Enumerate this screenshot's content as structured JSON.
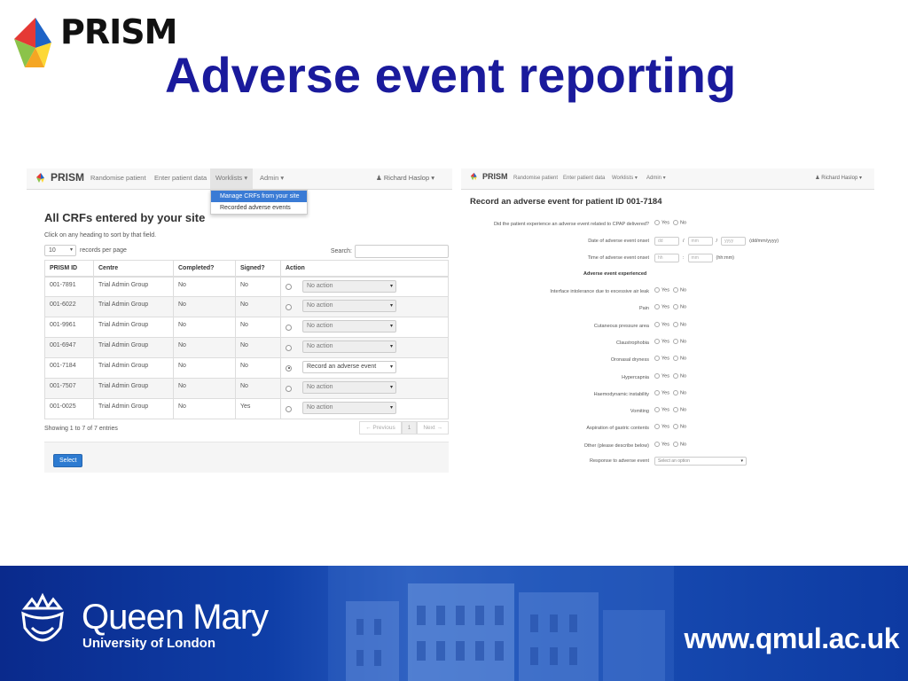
{
  "slide": {
    "logo_text": "PRISM",
    "title": "Adverse event reporting"
  },
  "nav": {
    "brand": "PRISM",
    "items": [
      "Randomise patient",
      "Enter patient data",
      "Worklists ▾",
      "Admin ▾"
    ],
    "user": "Richard Haslop ▾"
  },
  "worklists_menu": {
    "items": [
      "Manage CRFs from your site",
      "Recorded adverse events"
    ]
  },
  "crf_list": {
    "title": "All CRFs entered by your site",
    "hint": "Click on any heading to sort by that field.",
    "page_size": "10",
    "page_size_label": "records per page",
    "search_label": "Search:",
    "search_value": "",
    "columns": [
      "PRISM ID",
      "Centre",
      "Completed?",
      "Signed?",
      "Action"
    ],
    "rows": [
      {
        "id": "001-7891",
        "centre": "Trial Admin Group",
        "completed": "No",
        "signed": "No",
        "action": "No action",
        "selected": false
      },
      {
        "id": "001-6022",
        "centre": "Trial Admin Group",
        "completed": "No",
        "signed": "No",
        "action": "No action",
        "selected": false
      },
      {
        "id": "001-9961",
        "centre": "Trial Admin Group",
        "completed": "No",
        "signed": "No",
        "action": "No action",
        "selected": false
      },
      {
        "id": "001-6947",
        "centre": "Trial Admin Group",
        "completed": "No",
        "signed": "No",
        "action": "No action",
        "selected": false
      },
      {
        "id": "001-7184",
        "centre": "Trial Admin Group",
        "completed": "No",
        "signed": "No",
        "action": "Record an adverse event",
        "selected": true
      },
      {
        "id": "001-7507",
        "centre": "Trial Admin Group",
        "completed": "No",
        "signed": "No",
        "action": "No action",
        "selected": false
      },
      {
        "id": "001-0025",
        "centre": "Trial Admin Group",
        "completed": "No",
        "signed": "Yes",
        "action": "No action",
        "selected": false
      }
    ],
    "showing": "Showing 1 to 7 of 7 entries",
    "pager": {
      "prev": "← Previous",
      "page": "1",
      "next": "Next →"
    },
    "select_button": "Select"
  },
  "ae_form": {
    "title": "Record an adverse event for patient ID 001-7184",
    "cpap_question": "Did the patient experience an adverse event related to CPAP delivered?",
    "yes": "Yes",
    "no": "No",
    "date_label": "Date of adverse event onset",
    "date_dd": "dd",
    "date_mm": "mm",
    "date_yyyy": "yyyy",
    "date_sep": "/",
    "date_format": "(dd/mm/yyyy)",
    "time_label": "Time of adverse event onset",
    "time_hh": "hh",
    "time_sep": ":",
    "time_mm": "mm",
    "time_format": "(hh:mm)",
    "section": "Adverse event experienced",
    "events": [
      "Interface intolerance due to excessive air leak",
      "Pain",
      "Cutaneous pressure area",
      "Claustrophobia",
      "Oronasal dryness",
      "Hypercapnia",
      "Haemodynamic instability",
      "Vomiting",
      "Aspiration of gastric contents",
      "Other (please describe below)"
    ],
    "response_label": "Response to adverse event",
    "response_placeholder": "Select an option"
  },
  "banner": {
    "name": "Queen Mary",
    "sub": "University of London",
    "url": "www.qmul.ac.uk"
  },
  "colors": {
    "title": "#1a1a9c",
    "banner": "#0f3fa8",
    "button": "#2d7bd1",
    "menu_highlight": "#3a7bd5"
  }
}
